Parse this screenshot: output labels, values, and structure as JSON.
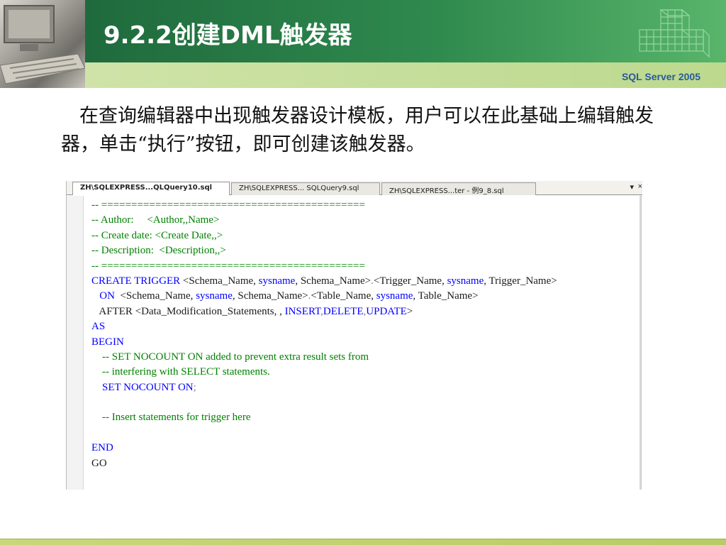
{
  "slide": {
    "title": "9.2.2创建DML触发器",
    "brand": "SQL  Server 2005",
    "paragraph": "在查询编辑器中出现触发器设计模板，用户可以在此基础上编辑触发器，单击“执行”按钮，即可创建该触发器。"
  },
  "editor": {
    "tabs": [
      {
        "label": "ZH\\SQLEXPRESS...QLQuery10.sql",
        "active": true
      },
      {
        "label": "ZH\\SQLEXPRESS... SQLQuery9.sql",
        "active": false
      },
      {
        "label": "ZH\\SQLEXPRESS...ter - 例9_8.sql",
        "active": false
      }
    ],
    "tab_menu_glyph": "▾",
    "tab_close_glyph": "×",
    "lines": [
      [
        {
          "t": "-- ============================================",
          "c": "green"
        }
      ],
      [
        {
          "t": "-- Author:     <Author,,Name>",
          "c": "green"
        }
      ],
      [
        {
          "t": "-- Create date: <Create Date,,>",
          "c": "green"
        }
      ],
      [
        {
          "t": "-- Description:  <Description,,>",
          "c": "green"
        }
      ],
      [
        {
          "t": "-- ============================================",
          "c": "green"
        }
      ],
      [
        {
          "t": "CREATE TRIGGER ",
          "c": "blue"
        },
        {
          "t": "<Schema_Name, ",
          "c": "black"
        },
        {
          "t": "sysname",
          "c": "blue"
        },
        {
          "t": ", Schema_Name>",
          "c": "black"
        },
        {
          "t": ".",
          "c": "gray"
        },
        {
          "t": "<Trigger_Name, ",
          "c": "black"
        },
        {
          "t": "sysname",
          "c": "blue"
        },
        {
          "t": ", Trigger_Name>",
          "c": "black"
        }
      ],
      [
        {
          "t": "   ON  ",
          "c": "blue"
        },
        {
          "t": "<Schema_Name, ",
          "c": "black"
        },
        {
          "t": "sysname",
          "c": "blue"
        },
        {
          "t": ", Schema_Name>",
          "c": "black"
        },
        {
          "t": ".",
          "c": "gray"
        },
        {
          "t": "<Table_Name, ",
          "c": "black"
        },
        {
          "t": "sysname",
          "c": "blue"
        },
        {
          "t": ", Table_Name>",
          "c": "black"
        }
      ],
      [
        {
          "t": "   AFTER ",
          "c": "black"
        },
        {
          "t": "<Data_Modification_Statements, , ",
          "c": "black"
        },
        {
          "t": "INSERT",
          "c": "blue"
        },
        {
          "t": ",",
          "c": "gray"
        },
        {
          "t": "DELETE",
          "c": "blue"
        },
        {
          "t": ",",
          "c": "gray"
        },
        {
          "t": "UPDATE",
          "c": "blue"
        },
        {
          "t": ">",
          "c": "black"
        }
      ],
      [
        {
          "t": "AS",
          "c": "blue"
        }
      ],
      [
        {
          "t": "BEGIN",
          "c": "blue"
        }
      ],
      [
        {
          "t": "    -- SET NOCOUNT ON added to prevent extra result sets from",
          "c": "green"
        }
      ],
      [
        {
          "t": "    -- interfering with SELECT statements.",
          "c": "green"
        }
      ],
      [
        {
          "t": "    SET NOCOUNT ON",
          "c": "blue"
        },
        {
          "t": ";",
          "c": "gray"
        }
      ],
      [
        {
          "t": " ",
          "c": "black"
        }
      ],
      [
        {
          "t": "    -- Insert statements for trigger here",
          "c": "green"
        }
      ],
      [
        {
          "t": " ",
          "c": "black"
        }
      ],
      [
        {
          "t": "END",
          "c": "blue"
        }
      ],
      [
        {
          "t": "GO",
          "c": "black"
        }
      ]
    ]
  },
  "colors": {
    "header_green": "#2f8a4e",
    "header_light": "#cfe3a8",
    "brand_blue": "#2a5a9a",
    "sql_keyword": "#0000ff",
    "sql_comment": "#008000"
  }
}
